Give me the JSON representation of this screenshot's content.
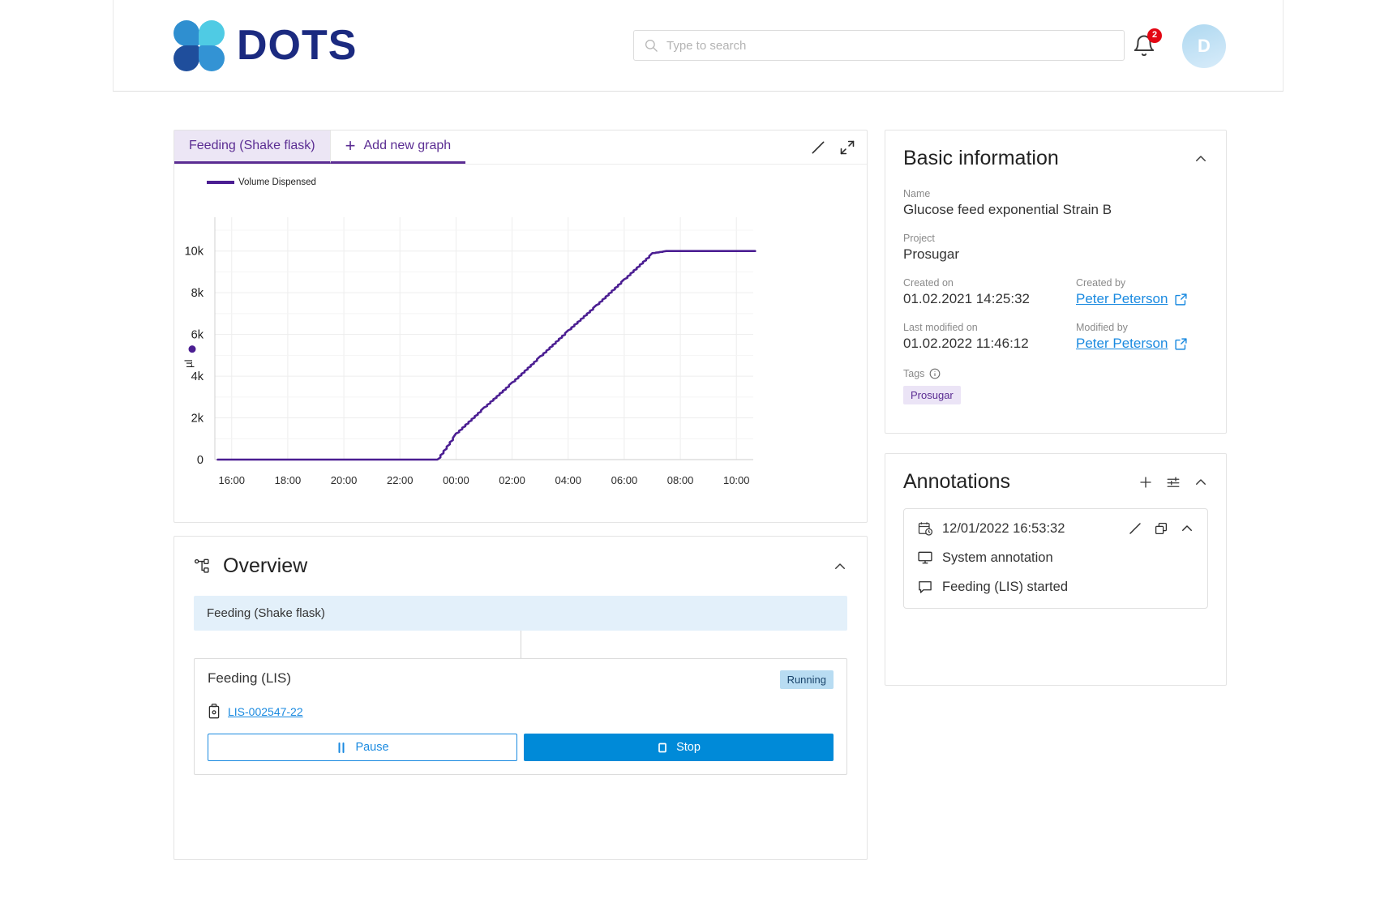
{
  "header": {
    "brand_name": "DOTS",
    "logo_icon": "dots-logo",
    "search": {
      "placeholder": "Type to search",
      "value": "",
      "icon": "search-icon"
    },
    "notifications": {
      "icon": "bell-icon",
      "count": "2",
      "badge_color": "#e30613"
    },
    "avatar": {
      "initial": "D"
    }
  },
  "graph_panel": {
    "tabs": [
      {
        "label": "Feeding (Shake flask)",
        "active": true
      },
      {
        "label": "Add new graph",
        "active": false,
        "icon": "plus-icon"
      }
    ],
    "tools": [
      {
        "name": "edit-pencil-icon",
        "label": "Edit"
      },
      {
        "name": "expand-icon",
        "label": "Expand"
      }
    ]
  },
  "chart_data": {
    "type": "line",
    "title": "",
    "xlabel": "",
    "ylabel": "µl",
    "legend": [
      {
        "name": "Volume Dispensed",
        "color": "#4b1e92"
      }
    ],
    "legend_position": "top-left",
    "grid": true,
    "xticks": [
      "16:00",
      "18:00",
      "20:00",
      "22:00",
      "00:00",
      "02:00",
      "04:00",
      "06:00",
      "08:00",
      "10:00"
    ],
    "yticks": [
      "0",
      "2k",
      "4k",
      "6k",
      "8k",
      "10k"
    ],
    "ylim": [
      0,
      11000
    ],
    "xlim_hours": [
      15.4,
      10.6
    ],
    "series": [
      {
        "name": "Volume Dispensed",
        "color": "#4b1e92",
        "x": [
          "15:30",
          "16:00",
          "17:00",
          "18:00",
          "19:00",
          "20:00",
          "21:00",
          "22:00",
          "23:00",
          "23:20",
          "00:00",
          "01:00",
          "02:00",
          "03:00",
          "04:00",
          "05:00",
          "06:00",
          "07:00",
          "07:30",
          "08:00",
          "09:00",
          "10:00",
          "10:40"
        ],
        "y": [
          0,
          0,
          0,
          0,
          0,
          0,
          0,
          0,
          0,
          0,
          1250,
          2500,
          3700,
          4950,
          6200,
          7400,
          8650,
          9900,
          10000,
          10000,
          10000,
          10000,
          10000
        ]
      }
    ],
    "marker_point": {
      "x": "15:30",
      "y": 5300,
      "color": "#4b1e92",
      "shape": "circle"
    }
  },
  "basic_information": {
    "title": "Basic information",
    "collapse_icon": "chevron-up-icon",
    "fields": {
      "name_label": "Name",
      "name_value": "Glucose feed exponential Strain B",
      "project_label": "Project",
      "project_value": "Prosugar",
      "created_on_label": "Created on",
      "created_on_value": "01.02.2021 14:25:32",
      "created_by_label": "Created by",
      "created_by_value": "Peter Peterson",
      "last_modified_label": "Last modified on",
      "last_modified_value": "01.02.2022 11:46:12",
      "modified_by_label": "Modified by",
      "modified_by_value": "Peter Peterson",
      "tags_label": "Tags",
      "tags": [
        "Prosugar"
      ]
    }
  },
  "annotations": {
    "title": "Annotations",
    "actions": [
      {
        "name": "add-annotation-icon",
        "label": "Add"
      },
      {
        "name": "filter-settings-icon",
        "label": "Filter"
      },
      {
        "name": "chevron-up-icon",
        "label": "Collapse"
      }
    ],
    "items": [
      {
        "timestamp": "12/01/2022 16:53:32",
        "date_icon": "calendar-clock-icon",
        "source_icon": "monitor-icon",
        "source": "System annotation",
        "comment_icon": "comment-icon",
        "comment": "Feeding (LIS) started",
        "row_actions": [
          {
            "name": "edit-pencil-icon"
          },
          {
            "name": "copy-icon"
          },
          {
            "name": "chevron-up-icon"
          }
        ]
      }
    ]
  },
  "overview": {
    "title": "Overview",
    "icon": "sitemap-icon",
    "collapse_icon": "chevron-up-icon",
    "root_node": "Feeding (Shake flask)",
    "node": {
      "title": "Feeding (LIS)",
      "status": "Running",
      "device_icon": "device-icon",
      "device_id": "LIS-002547-22",
      "buttons": [
        {
          "label": "Pause",
          "icon": "pause-icon",
          "style": "outline"
        },
        {
          "label": "Stop",
          "icon": "stop-icon",
          "style": "solid"
        }
      ]
    }
  }
}
